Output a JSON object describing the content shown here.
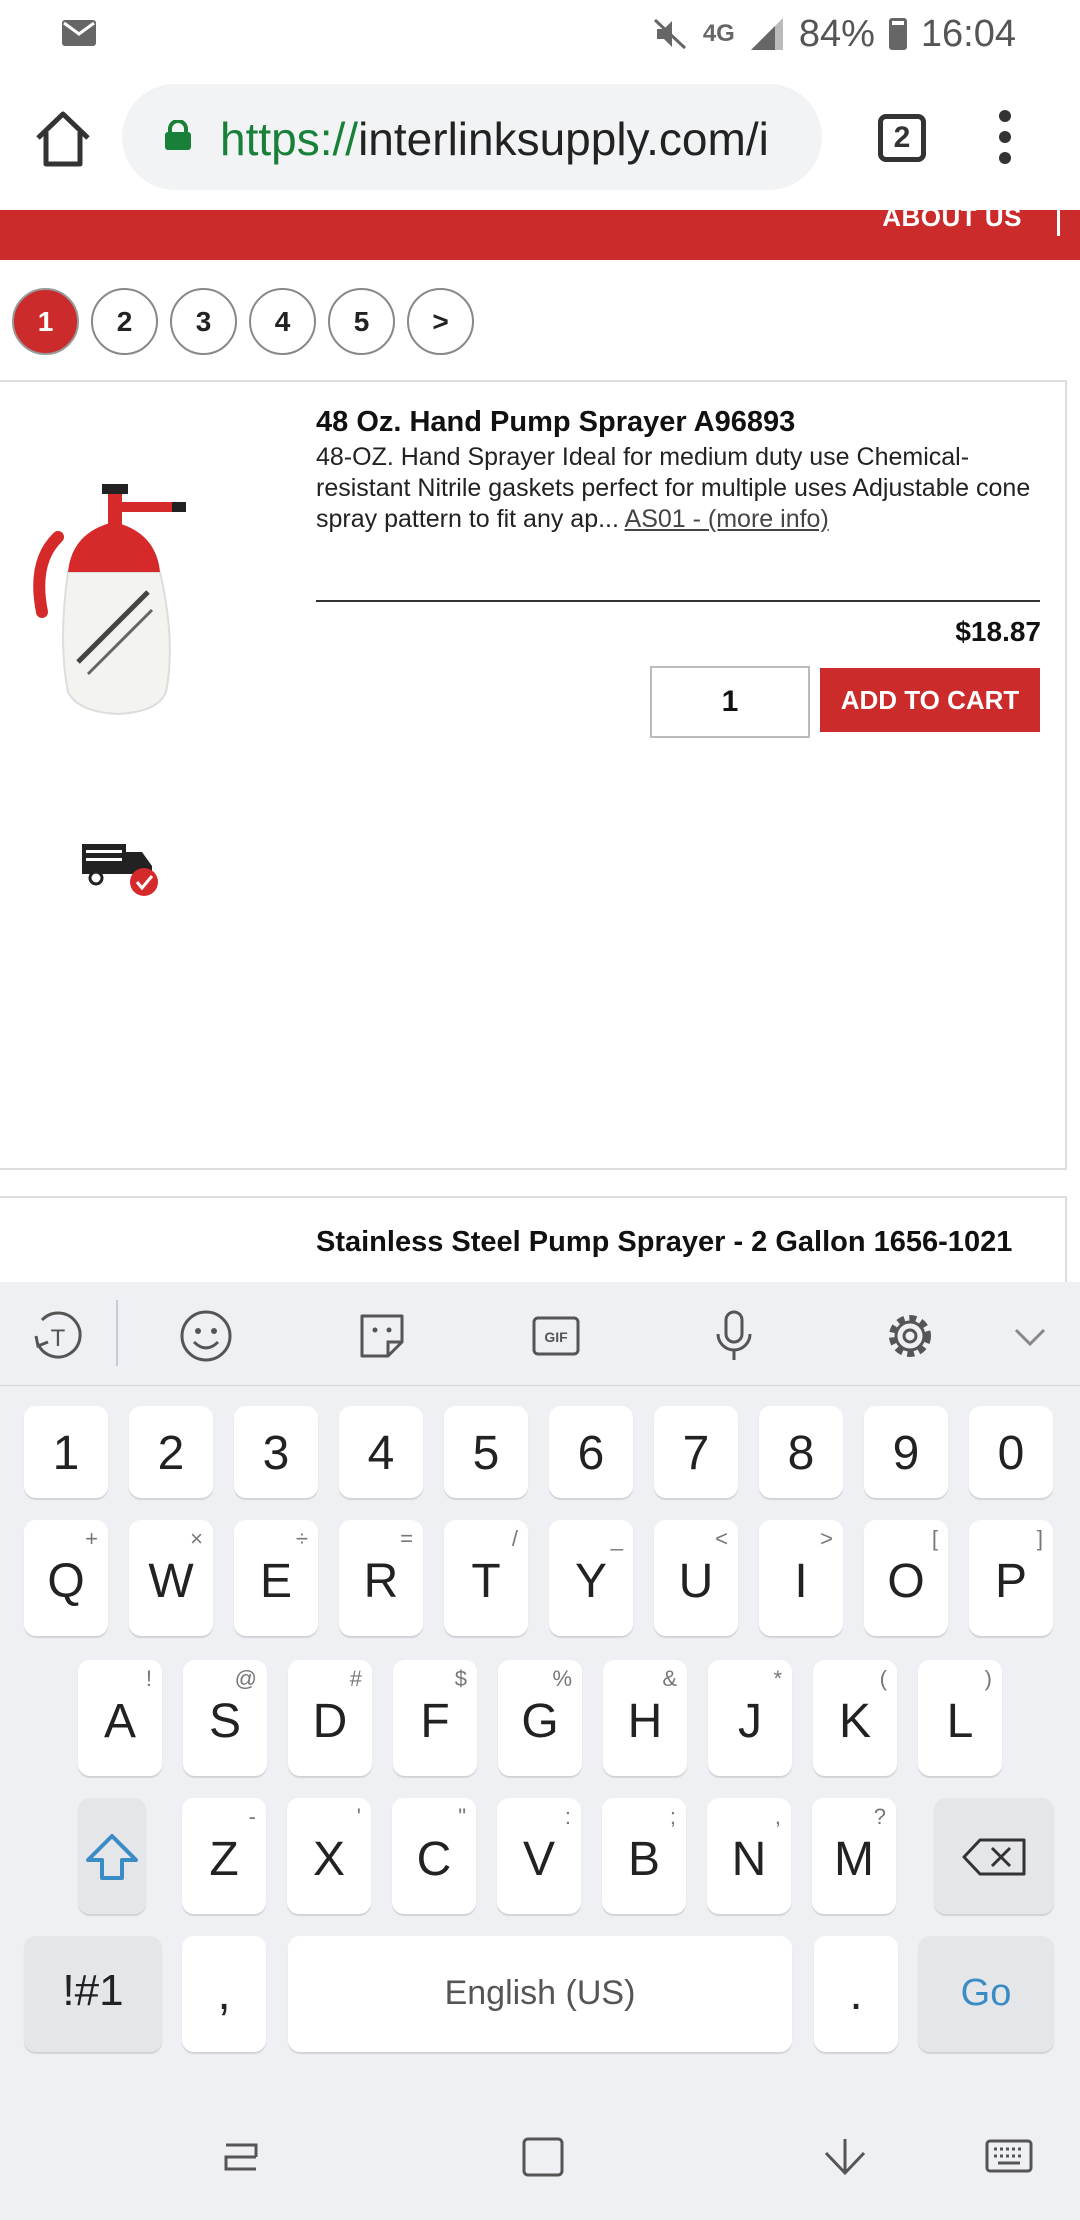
{
  "status_bar": {
    "battery": "84%",
    "time": "16:04",
    "network": "4G"
  },
  "browser": {
    "url_scheme": "https://",
    "url_rest": "interlinksupply.com/i",
    "tab_count": "2"
  },
  "site": {
    "nav_about": "ABOUT US"
  },
  "pagination": [
    "1",
    "2",
    "3",
    "4",
    "5",
    ">"
  ],
  "products": [
    {
      "title": "48 Oz. Hand Pump Sprayer A96893",
      "description": "48-OZ. Hand Sprayer Ideal for medium duty use Chemical-resistant Nitrile gaskets perfect for multiple uses Adjustable cone spray pattern to fit any ap...",
      "more_link": "AS01 - (more info)",
      "price": "$18.87",
      "quantity": "1",
      "add_to_cart": "ADD TO CART"
    },
    {
      "title": "Stainless Steel Pump Sprayer - 2 Gallon 1656-1021"
    }
  ],
  "keyboard": {
    "number_row": [
      "1",
      "2",
      "3",
      "4",
      "5",
      "6",
      "7",
      "8",
      "9",
      "0"
    ],
    "row1": [
      {
        "k": "Q",
        "s": "+"
      },
      {
        "k": "W",
        "s": "×"
      },
      {
        "k": "E",
        "s": "÷"
      },
      {
        "k": "R",
        "s": "="
      },
      {
        "k": "T",
        "s": "/"
      },
      {
        "k": "Y",
        "s": "_"
      },
      {
        "k": "U",
        "s": "<"
      },
      {
        "k": "I",
        "s": ">"
      },
      {
        "k": "O",
        "s": "["
      },
      {
        "k": "P",
        "s": "]"
      }
    ],
    "row2": [
      {
        "k": "A",
        "s": "!"
      },
      {
        "k": "S",
        "s": "@"
      },
      {
        "k": "D",
        "s": "#"
      },
      {
        "k": "F",
        "s": "$"
      },
      {
        "k": "G",
        "s": "%"
      },
      {
        "k": "H",
        "s": "&"
      },
      {
        "k": "J",
        "s": "*"
      },
      {
        "k": "K",
        "s": "("
      },
      {
        "k": "L",
        "s": ")"
      }
    ],
    "row3": [
      {
        "k": "Z",
        "s": "-"
      },
      {
        "k": "X",
        "s": "'"
      },
      {
        "k": "C",
        "s": "\""
      },
      {
        "k": "V",
        "s": ":"
      },
      {
        "k": "B",
        "s": ";"
      },
      {
        "k": "N",
        "s": ","
      },
      {
        "k": "M",
        "s": "?"
      }
    ],
    "symbols_key": "!#1",
    "comma_key": ",",
    "space_label": "English (US)",
    "period_key": ".",
    "go_key": "Go"
  },
  "colors": {
    "brand_red": "#cc2b2b",
    "lock_green": "#188038",
    "go_blue": "#3a8cc4"
  }
}
